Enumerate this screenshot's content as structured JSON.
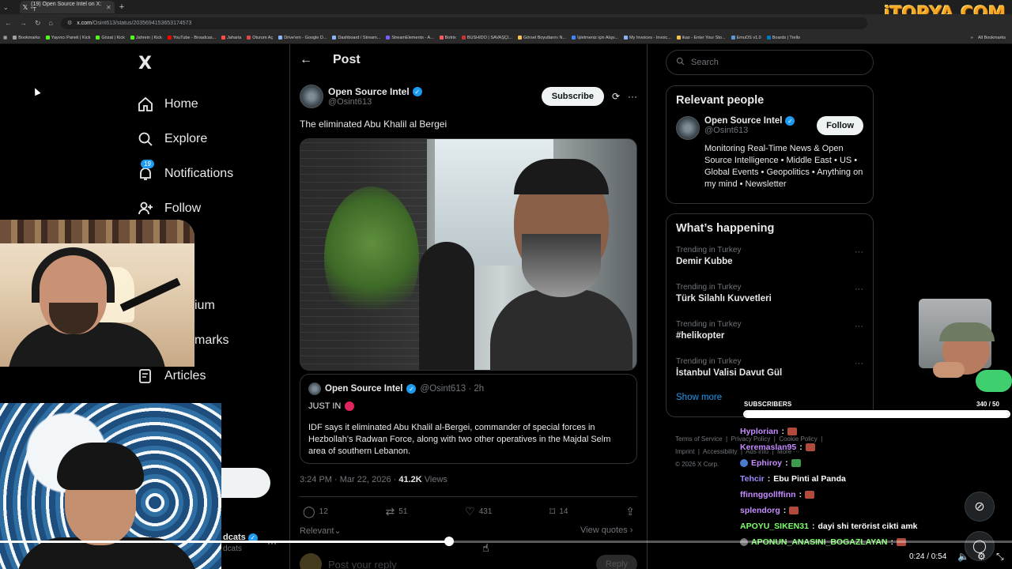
{
  "browser": {
    "tab_title": "(19) Open Source Intel on X: \"T",
    "url_host": "x.com",
    "url_path": "/Osint613/status/2035694153653174573",
    "brand_logo": "iTOPYA.COM",
    "bookmarks": [
      {
        "label": "Bookmarks",
        "color": "#9aa0a6"
      },
      {
        "label": "Yayıncı Paneli | Kick",
        "color": "#53fc18"
      },
      {
        "label": "Gözat | Kick",
        "color": "#53fc18"
      },
      {
        "label": "Jahrein | Kick",
        "color": "#53fc18"
      },
      {
        "label": "YouTube - Broadcas...",
        "color": "#ff0000"
      },
      {
        "label": "Jaharia",
        "color": "#ff4d4d"
      },
      {
        "label": "Oturum Aç",
        "color": "#e04848"
      },
      {
        "label": "Drive'em - Google D...",
        "color": "#8ab4f8"
      },
      {
        "label": "Dashboard / Stream...",
        "color": "#8ab4f8"
      },
      {
        "label": "StreamElements - A...",
        "color": "#7b5cff"
      },
      {
        "label": "Botrix",
        "color": "#ff5a5a"
      },
      {
        "label": "BUSHIDO | SAVAŞÇI...",
        "color": "#c33"
      },
      {
        "label": "Görsel Boyutlarını N...",
        "color": "#f2c14e"
      },
      {
        "label": "İşletmeniz için Alışv...",
        "color": "#4285f4"
      },
      {
        "label": "My Invoices - Invoic...",
        "color": "#8ab4f8"
      },
      {
        "label": "ikas - Enter Your Sto...",
        "color": "#f2c14e"
      },
      {
        "label": "EmuOS v1.0",
        "color": "#5b9bd5"
      },
      {
        "label": "Boards | Trello",
        "color": "#0079bf"
      }
    ],
    "all_bookmarks": "All Bookmarks"
  },
  "nav": {
    "logo": "X",
    "items": [
      {
        "label": "Home",
        "icon": "home-icon"
      },
      {
        "label": "Explore",
        "icon": "search-icon"
      },
      {
        "label": "Notifications",
        "icon": "bell-icon",
        "badge": "19"
      },
      {
        "label": "Follow",
        "icon": "person-add-icon"
      }
    ],
    "partial_items": [
      "ium",
      "marks"
    ],
    "articles": "Articles"
  },
  "post": {
    "header": "Post",
    "author_name": "Open Source Intel",
    "author_handle": "@Osint613",
    "subscribe": "Subscribe",
    "text": "The eliminated Abu Khalil al Bergei",
    "quote": {
      "author_name": "Open Source Intel",
      "handle_time": "@Osint613 · 2h",
      "just_in": "JUST IN",
      "body": "IDF says it eliminated Abu Khalil al-Bergei, commander of special forces in Hezbollah's Radwan Force, along with two other operatives in the Majdal Selm area of southern Lebanon."
    },
    "timestamp": "3:24 PM · Mar 22, 2026 ·",
    "views_count": "41.2K",
    "views_label": "Views",
    "actions": {
      "replies": "12",
      "reposts": "51",
      "likes": "431",
      "bookmarks": "14"
    },
    "relevant": "Relevant",
    "view_quotes": "View quotes",
    "reply_placeholder": "Post your reply",
    "reply_button": "Reply"
  },
  "sidebar": {
    "search_placeholder": "Search",
    "relevant_title": "Relevant people",
    "person": {
      "name": "Open Source Intel",
      "handle": "@Osint613",
      "follow": "Follow",
      "bio": "Monitoring Real-Time News & Open Source Intelligence • Middle East • US • Global Events • Geopolitics • Anything on my mind • Newsletter"
    },
    "happening_title": "What’s happening",
    "trends": [
      {
        "context": "Trending in Turkey",
        "name": "Demir Kubbe"
      },
      {
        "context": "Trending in Turkey",
        "name": "Türk Silahlı Kuvvetleri"
      },
      {
        "context": "Trending in Turkey",
        "name": "#helikopter"
      },
      {
        "context": "Trending in Turkey",
        "name": "İstanbul Valisi Davut Gül"
      }
    ],
    "show_more": "Show more",
    "footer": [
      "Terms of Service",
      "Privacy Policy",
      "Cookie Policy",
      "Imprint",
      "Accessibility",
      "Ads info",
      "More ···",
      "© 2026 X Corp."
    ]
  },
  "overlay": {
    "ghost_user": "dcats",
    "ghost_user2": "dcats",
    "subs_label": "SUBSCRIBERS",
    "subs_count": "340 / 50",
    "subs_progress": 1.0,
    "chat": [
      {
        "user": "Hyplorian",
        "color": "#c58bff",
        "msg": "",
        "emote": true,
        "icon": false
      },
      {
        "user": "Keremaslan95",
        "color": "#c58bff",
        "msg": "",
        "emote": true,
        "icon": false
      },
      {
        "user": "Ephiroy",
        "color": "#c58bff",
        "msg": "",
        "emote": true,
        "icon": true,
        "emote_green": true
      },
      {
        "user": "Tehcir",
        "color": "#9b8cff",
        "msg": "Ebu Pinti al Panda",
        "emote": false,
        "icon": false
      },
      {
        "user": "ffinnggollffinn",
        "color": "#c58bff",
        "msg": "",
        "emote": true,
        "icon": false
      },
      {
        "user": "splendorg",
        "color": "#c58bff",
        "msg": "",
        "emote": true,
        "icon": false
      },
      {
        "user": "APOYU_SIKEN31",
        "color": "#7dff6a",
        "msg": "dayi shi terörist cikti amk",
        "emote": false,
        "icon": false
      },
      {
        "user": "APONUN_ANASINI_BOGAZLAYAN",
        "color": "#7dff6a",
        "msg": "",
        "emote": true,
        "icon": true
      }
    ]
  },
  "video": {
    "time": "0:24 / 0:54",
    "progress": 0.444
  }
}
